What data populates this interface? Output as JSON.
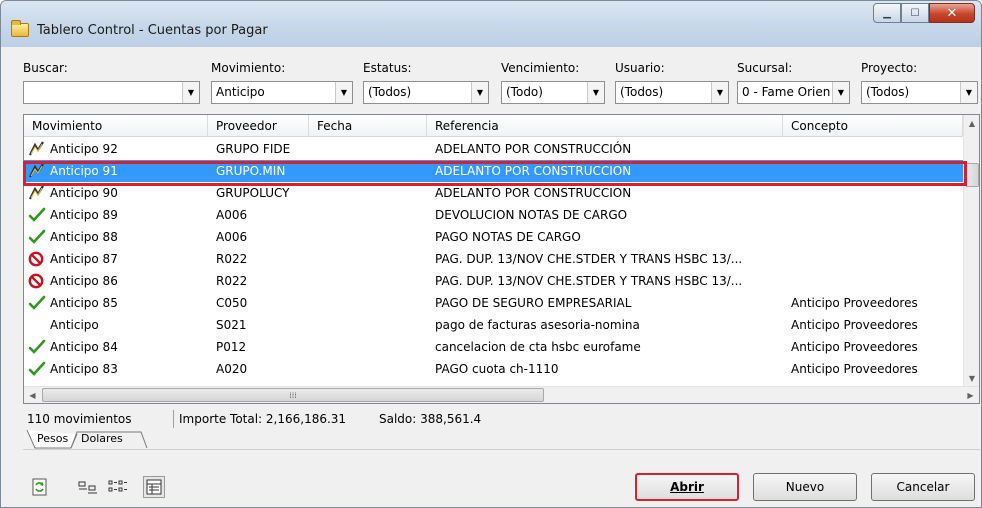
{
  "window": {
    "title": "Tablero Control - Cuentas por Pagar"
  },
  "filters": [
    {
      "label": "Buscar:",
      "value": ""
    },
    {
      "label": "Movimiento:",
      "value": "Anticipo"
    },
    {
      "label": "Estatus:",
      "value": "(Todos)"
    },
    {
      "label": "Vencimiento:",
      "value": "(Todo)"
    },
    {
      "label": "Usuario:",
      "value": "(Todos)"
    },
    {
      "label": "Sucursal:",
      "value": "0 - Fame Orien"
    },
    {
      "label": "Proyecto:",
      "value": "(Todos)"
    }
  ],
  "grid": {
    "columns": [
      "Movimiento",
      "Proveedor",
      "Fecha",
      "Referencia",
      "Concepto"
    ],
    "rows": [
      {
        "status": "pending",
        "movimiento": "Anticipo 92",
        "proveedor": "GRUPO FIDE",
        "fecha": "",
        "referencia": "ADELANTO POR CONSTRUCCIÓN",
        "concepto": ""
      },
      {
        "status": "pending",
        "movimiento": "Anticipo 91",
        "proveedor": "GRUPO.MIN",
        "fecha": "",
        "referencia": "ADELANTO POR CONSTRUCCION",
        "concepto": "",
        "selected": true
      },
      {
        "status": "pending",
        "movimiento": "Anticipo 90",
        "proveedor": "GRUPOLUCY",
        "fecha": "",
        "referencia": "ADELANTO POR CONSTRUCCION",
        "concepto": ""
      },
      {
        "status": "done",
        "movimiento": "Anticipo 89",
        "proveedor": "A006",
        "fecha": "",
        "referencia": "DEVOLUCION NOTAS DE CARGO",
        "concepto": ""
      },
      {
        "status": "done",
        "movimiento": "Anticipo 88",
        "proveedor": "A006",
        "fecha": "",
        "referencia": "PAGO NOTAS DE CARGO",
        "concepto": ""
      },
      {
        "status": "cancelled",
        "movimiento": "Anticipo 87",
        "proveedor": "R022",
        "fecha": "",
        "referencia": "PAG. DUP. 13/NOV CHE.STDER  Y TRANS HSBC 13/...",
        "concepto": ""
      },
      {
        "status": "cancelled",
        "movimiento": "Anticipo 86",
        "proveedor": "R022",
        "fecha": "",
        "referencia": "PAG. DUP. 13/NOV CHE.STDER  Y TRANS HSBC 13/...",
        "concepto": ""
      },
      {
        "status": "done",
        "movimiento": "Anticipo 85",
        "proveedor": "C050",
        "fecha": "",
        "referencia": "PAGO DE SEGURO EMPRESARIAL",
        "concepto": "Anticipo Proveedores"
      },
      {
        "status": "none",
        "movimiento": "Anticipo",
        "proveedor": "S021",
        "fecha": "",
        "referencia": "pago de facturas asesoria-nomina",
        "concepto": "Anticipo Proveedores"
      },
      {
        "status": "done",
        "movimiento": "Anticipo 84",
        "proveedor": "P012",
        "fecha": "",
        "referencia": "cancelacion de cta hsbc eurofame",
        "concepto": "Anticipo Proveedores"
      },
      {
        "status": "done",
        "movimiento": "Anticipo 83",
        "proveedor": "A020",
        "fecha": "",
        "referencia": "PAGO cuota ch-1110",
        "concepto": "Anticipo Proveedores"
      }
    ]
  },
  "status": {
    "count": "110 movimientos",
    "importe": "Importe Total: 2,166,186.31",
    "saldo": "Saldo: 388,561.4"
  },
  "tabs": [
    "Pesos",
    "Dolares"
  ],
  "buttons": {
    "open": "Abrir",
    "new": "Nuevo",
    "cancel": "Cancelar"
  },
  "colors": {
    "selection": "#3399ff",
    "highlight": "#d9202f",
    "check": "#2e9a1e",
    "cancel": "#c8141e"
  }
}
